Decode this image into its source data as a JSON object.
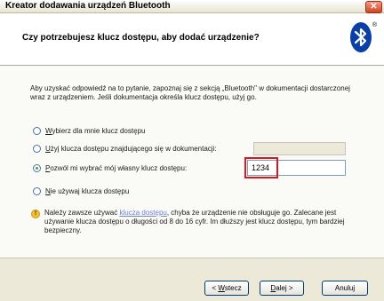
{
  "window": {
    "title": "Kreator dodawania urządzeń Bluetooth",
    "close_glyph": "✕"
  },
  "header": {
    "title": "Czy potrzebujesz klucz dostępu, aby dodać urządzenie?",
    "logo_icon": "bluetooth-icon",
    "registered_mark": "®"
  },
  "intro": "Aby uzyskać odpowiedź na to pytanie, zapoznaj się z sekcją „Bluetooth\" w dokumentacji dostarczonej wraz z urządzeniem. Jeśli dokumentacja określa klucz dostępu, użyj go.",
  "options": [
    {
      "pre": "",
      "ul": "W",
      "post": "ybierz dla mnie klucz dostępu",
      "checked": false
    },
    {
      "pre": "",
      "ul": "U",
      "post": "żyj klucza dostępu znajdującego się w dokumentacji:",
      "checked": false
    },
    {
      "pre": "",
      "ul": "P",
      "post": "ozwól mi wybrać mój własny klucz dostępu:",
      "checked": true
    },
    {
      "pre": "",
      "ul": "N",
      "post": "ie używaj klucza dostępu",
      "checked": false
    }
  ],
  "fields": {
    "documentation_key": "",
    "own_key": "1234"
  },
  "note": {
    "icon_glyph": "!",
    "before_link": "Należy zawsze używać ",
    "link": "klucza dostępu",
    "after_link": ", chyba że urządzenie nie obsługuje go. Zalecane jest używanie klucza dostępu o długości od 8 do 16 cyfr. Im dłuższy jest klucz dostępu, tym bardziej bezpieczny."
  },
  "buttons": {
    "back": {
      "pre": "< ",
      "ul": "W",
      "post": "stecz"
    },
    "next": {
      "pre": "",
      "ul": "D",
      "post": "alej >"
    },
    "cancel": {
      "pre": "",
      "ul": "",
      "post": "Anuluj"
    }
  },
  "colors": {
    "highlight": "#d61920",
    "accent_radio": "#3fa535",
    "link": "#6e83c9"
  }
}
